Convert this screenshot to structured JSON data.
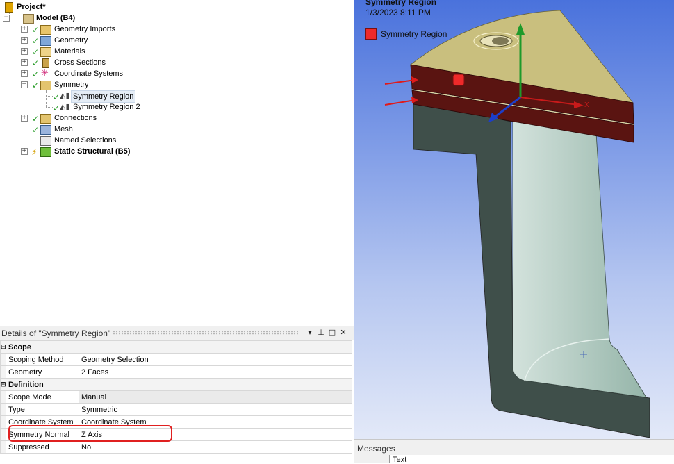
{
  "tree": {
    "project": "Project*",
    "model": "Model (B4)",
    "items": [
      {
        "label": "Geometry Imports"
      },
      {
        "label": "Geometry"
      },
      {
        "label": "Materials"
      },
      {
        "label": "Cross Sections"
      },
      {
        "label": "Coordinate Systems"
      },
      {
        "label": "Symmetry"
      },
      {
        "label": "Symmetry Region"
      },
      {
        "label": "Symmetry Region 2"
      },
      {
        "label": "Connections"
      },
      {
        "label": "Mesh"
      },
      {
        "label": "Named Selections"
      }
    ],
    "static_structural": "Static Structural (B5)"
  },
  "details": {
    "title": "Details of \"Symmetry Region\"",
    "sections": {
      "scope": "Scope",
      "definition": "Definition"
    },
    "rows": [
      {
        "label": "Scoping Method",
        "value": "Geometry Selection"
      },
      {
        "label": "Geometry",
        "value": "2 Faces"
      },
      {
        "label": "Scope Mode",
        "value": "Manual"
      },
      {
        "label": "Type",
        "value": "Symmetric"
      },
      {
        "label": "Coordinate System",
        "value": "Coordinate System"
      },
      {
        "label": "Symmetry Normal",
        "value": "Z Axis"
      },
      {
        "label": "Suppressed",
        "value": "No"
      }
    ],
    "collapse_glyph": "⊟"
  },
  "viewport": {
    "title": "Symmetry Region",
    "date": "1/3/2023 8:11 PM",
    "legend_label": "Symmetry Region",
    "axis_x": "X",
    "axis_y": "Y",
    "colors": {
      "selection": "#ee2a2a",
      "top_face": "#c9bf7e",
      "body_dark": "#3f4f4a",
      "body_light": "#a9c6bb"
    }
  },
  "messages": {
    "title": "Messages",
    "column": "Text"
  }
}
